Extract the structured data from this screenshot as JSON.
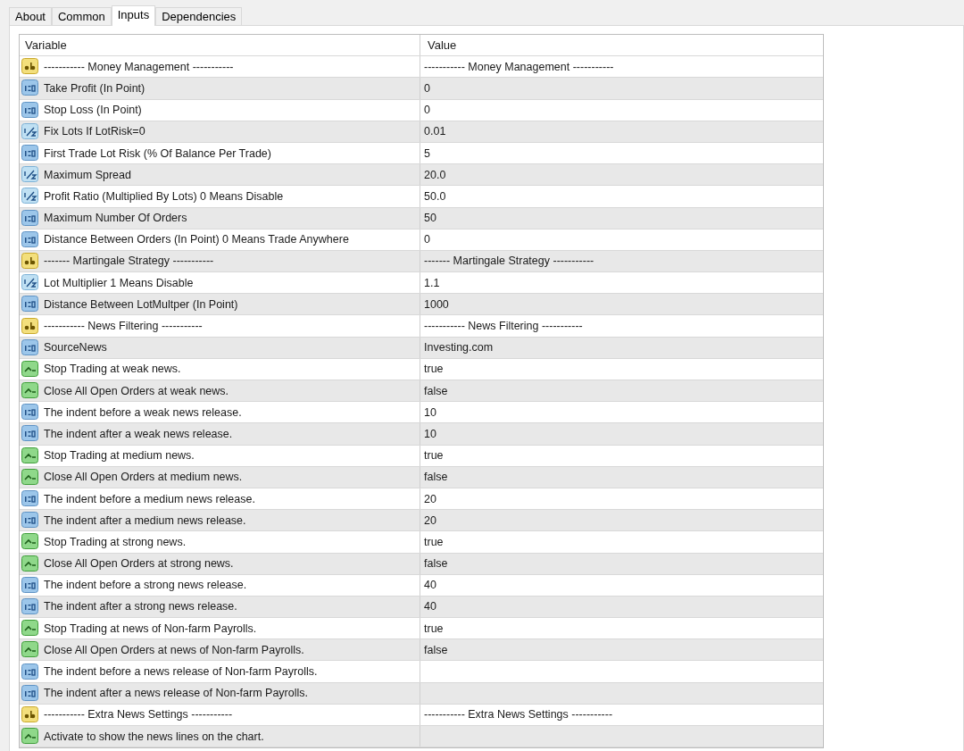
{
  "tabs": [
    {
      "label": "About",
      "selected": false
    },
    {
      "label": "Common",
      "selected": false
    },
    {
      "label": "Inputs",
      "selected": true
    },
    {
      "label": "Dependencies",
      "selected": false
    }
  ],
  "table": {
    "columns": [
      "Variable",
      "Value"
    ],
    "rows": [
      {
        "kind": "string",
        "variable": "----------- Money Management -----------",
        "value": "----------- Money Management -----------"
      },
      {
        "kind": "int",
        "variable": "Take Profit (In Point)",
        "value": "0"
      },
      {
        "kind": "int",
        "variable": "Stop Loss (In Point)",
        "value": "0"
      },
      {
        "kind": "double",
        "variable": "Fix Lots If LotRisk=0",
        "value": "0.01"
      },
      {
        "kind": "int",
        "variable": "First Trade Lot Risk (% Of Balance Per Trade)",
        "value": "5"
      },
      {
        "kind": "double",
        "variable": "Maximum Spread",
        "value": "20.0"
      },
      {
        "kind": "double",
        "variable": "Profit Ratio (Multiplied By Lots) 0 Means Disable",
        "value": "50.0"
      },
      {
        "kind": "int",
        "variable": "Maximum Number Of Orders",
        "value": "50"
      },
      {
        "kind": "int",
        "variable": "Distance Between Orders (In Point) 0 Means Trade Anywhere",
        "value": "0"
      },
      {
        "kind": "string",
        "variable": "------- Martingale Strategy -----------",
        "value": "------- Martingale Strategy -----------"
      },
      {
        "kind": "double",
        "variable": "Lot Multiplier 1 Means Disable",
        "value": "1.1"
      },
      {
        "kind": "int",
        "variable": "Distance Between LotMultper (In Point)",
        "value": "1000"
      },
      {
        "kind": "string",
        "variable": "----------- News Filtering -----------",
        "value": "----------- News Filtering -----------"
      },
      {
        "kind": "int",
        "variable": "SourceNews",
        "value": "Investing.com"
      },
      {
        "kind": "bool",
        "variable": "Stop Trading at weak news.",
        "value": "true"
      },
      {
        "kind": "bool",
        "variable": "Close All Open Orders at weak news.",
        "value": "false"
      },
      {
        "kind": "int",
        "variable": "The indent before a weak news release.",
        "value": "10"
      },
      {
        "kind": "int",
        "variable": "The indent after a weak news release.",
        "value": "10"
      },
      {
        "kind": "bool",
        "variable": "Stop Trading at medium news.",
        "value": "true"
      },
      {
        "kind": "bool",
        "variable": "Close All Open Orders at medium news.",
        "value": "false"
      },
      {
        "kind": "int",
        "variable": "The indent before a medium news release.",
        "value": "20"
      },
      {
        "kind": "int",
        "variable": "The indent after a medium news release.",
        "value": "20"
      },
      {
        "kind": "bool",
        "variable": "Stop Trading at strong news.",
        "value": "true"
      },
      {
        "kind": "bool",
        "variable": "Close All Open Orders at strong news.",
        "value": "false"
      },
      {
        "kind": "int",
        "variable": "The indent before a strong news release.",
        "value": "40"
      },
      {
        "kind": "int",
        "variable": "The indent after a strong news release.",
        "value": "40"
      },
      {
        "kind": "bool",
        "variable": "Stop Trading at news of Non-farm Payrolls.",
        "value": "true"
      },
      {
        "kind": "bool",
        "variable": "Close All Open Orders at news of Non-farm Payrolls.",
        "value": "false"
      },
      {
        "kind": "int",
        "variable": "The indent before a news release of Non-farm Payrolls."
      },
      {
        "kind": "int",
        "variable": "The indent after a news release of Non-farm Payrolls."
      },
      {
        "kind": "string",
        "variable": "----------- Extra News Settings -----------",
        "value": "----------- Extra News Settings -----------"
      },
      {
        "kind": "bool",
        "variable": "Activate to show the news lines on the chart."
      }
    ]
  }
}
